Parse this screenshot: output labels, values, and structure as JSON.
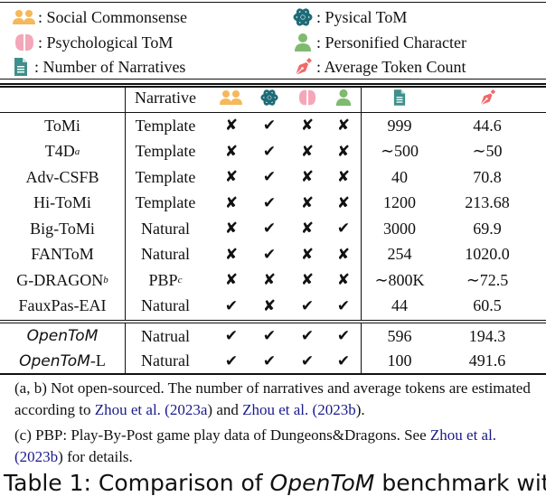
{
  "legend": {
    "items": [
      {
        "icon": "social-commonsense-icon",
        "label": ": Social Commonsense",
        "color": "#f5b85a"
      },
      {
        "icon": "physical-tom-icon",
        "label": ": Pysical ToM",
        "color": "#1e6b78"
      },
      {
        "icon": "psychological-tom-icon",
        "label": ": Psychological ToM",
        "color": "#f4a7b9"
      },
      {
        "icon": "personified-character-icon",
        "label": ": Personified Character",
        "color": "#7fba6f"
      },
      {
        "icon": "number-of-narratives-icon",
        "label": ": Number of Narratives",
        "color": "#3f8f8a"
      },
      {
        "icon": "average-token-count-icon",
        "label": ": Average Token Count",
        "color": "#ef6a6a"
      }
    ]
  },
  "table": {
    "header": {
      "narrative": "Narrative"
    },
    "marks": {
      "yes": "✔",
      "no": "✘"
    },
    "rows": [
      {
        "name": "ToMi",
        "sup": "",
        "narrative": "Template",
        "nsup": "",
        "social": "no",
        "physical": "yes",
        "psych": "no",
        "person": "no",
        "narratives": "999",
        "tokens": "44.6"
      },
      {
        "name": "T4D",
        "sup": "a",
        "narrative": "Template",
        "nsup": "",
        "social": "no",
        "physical": "yes",
        "psych": "no",
        "person": "no",
        "narratives": "∼500",
        "tokens": "∼50"
      },
      {
        "name": "Adv-CSFB",
        "sup": "",
        "narrative": "Template",
        "nsup": "",
        "social": "no",
        "physical": "yes",
        "psych": "no",
        "person": "no",
        "narratives": "40",
        "tokens": "70.8"
      },
      {
        "name": "Hi-ToMi",
        "sup": "",
        "narrative": "Template",
        "nsup": "",
        "social": "no",
        "physical": "yes",
        "psych": "no",
        "person": "no",
        "narratives": "1200",
        "tokens": "213.68"
      },
      {
        "name": "Big-ToMi",
        "sup": "",
        "narrative": "Natural",
        "nsup": "",
        "social": "no",
        "physical": "yes",
        "psych": "no",
        "person": "yes",
        "narratives": "3000",
        "tokens": "69.9"
      },
      {
        "name": "FANToM",
        "sup": "",
        "narrative": "Natural",
        "nsup": "",
        "social": "no",
        "physical": "yes",
        "psych": "no",
        "person": "no",
        "narratives": "254",
        "tokens": "1020.0"
      },
      {
        "name": "G-DRAGON",
        "sup": "b",
        "narrative": "PBP",
        "nsup": "c",
        "social": "no",
        "physical": "no",
        "psych": "no",
        "person": "no",
        "narratives": "∼800K",
        "tokens": "∼72.5"
      },
      {
        "name": "FauxPas-EAI",
        "sup": "",
        "narrative": "Natural",
        "nsup": "",
        "social": "yes",
        "physical": "no",
        "psych": "yes",
        "person": "yes",
        "narratives": "44",
        "tokens": "60.5"
      }
    ],
    "ours": [
      {
        "name": "OpenToM",
        "suffix": "",
        "narrative": "Natrual",
        "social": "yes",
        "physical": "yes",
        "psych": "yes",
        "person": "yes",
        "narratives": "596",
        "tokens": "194.3"
      },
      {
        "name": "OpenToM",
        "suffix": "-L",
        "narrative": "Natural",
        "social": "yes",
        "physical": "yes",
        "psych": "yes",
        "person": "yes",
        "narratives": "100",
        "tokens": "491.6"
      }
    ]
  },
  "notes": {
    "n1_pre": "(a, b) Not open-sourced. The number of narratives and average tokens are estimated according to ",
    "n1_cite1_name": "Zhou et al.",
    "n1_cite1_year": "2023a",
    "n1_mid": " and ",
    "n1_cite2_name": "Zhou et al.",
    "n1_cite2_year": "2023b",
    "n1_end": ").",
    "n2_pre": "(c) PBP: Play-By-Post game play data of Dungeons&Dragons. See ",
    "n2_cite_name": "Zhou et al.",
    "n2_cite_year": "2023b",
    "n2_end": ") for details."
  },
  "caption": {
    "pre": "Table 1: Comparison of ",
    "italic": "OpenToM",
    "post": " benchmark with"
  }
}
